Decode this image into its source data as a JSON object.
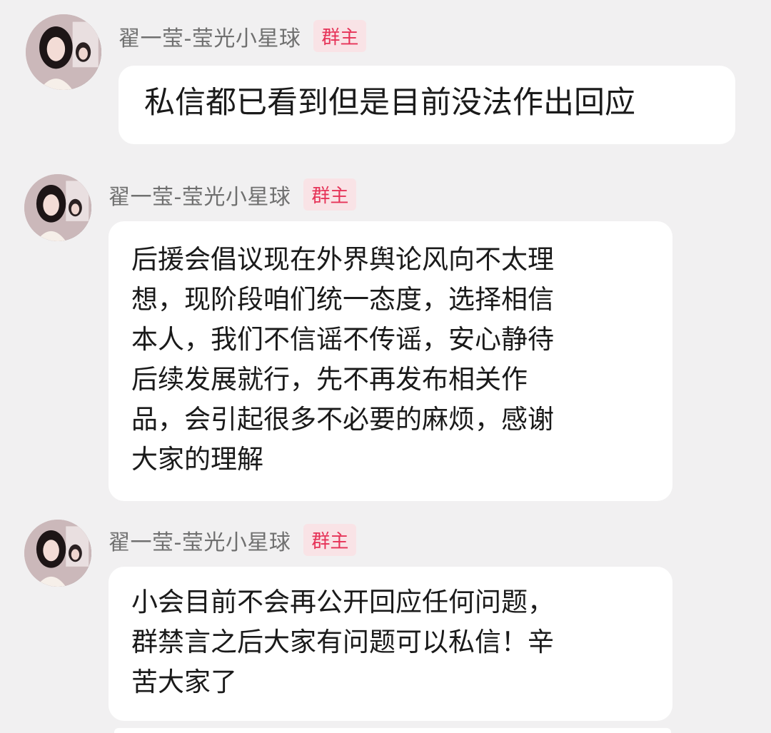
{
  "messages": [
    {
      "sender": "翟一莹-莹光小星球",
      "badge": "群主",
      "text": "私信都已看到但是目前没法作出回应"
    },
    {
      "sender": "翟一莹-莹光小星球",
      "badge": "群主",
      "text": "后援会倡议现在外界舆论风向不太理\n想，现阶段咱们统一态度，选择相信\n本人，我们不信谣不传谣，安心静待\n后续发展就行，先不再发布相关作\n品，会引起很多不必要的麻烦，感谢\n大家的理解"
    },
    {
      "sender": "翟一莹-莹光小星球",
      "badge": "群主",
      "text": "小会目前不会再公开回应任何问题，\n群禁言之后大家有问题可以私信！辛\n苦大家了"
    }
  ],
  "colors": {
    "background": "#f1f0f1",
    "bubble": "#ffffff",
    "badge_bg": "#f9e3e6",
    "badge_text": "#e63358",
    "sender_text": "#707070"
  },
  "icons": {
    "avatar": "profile-photo"
  }
}
